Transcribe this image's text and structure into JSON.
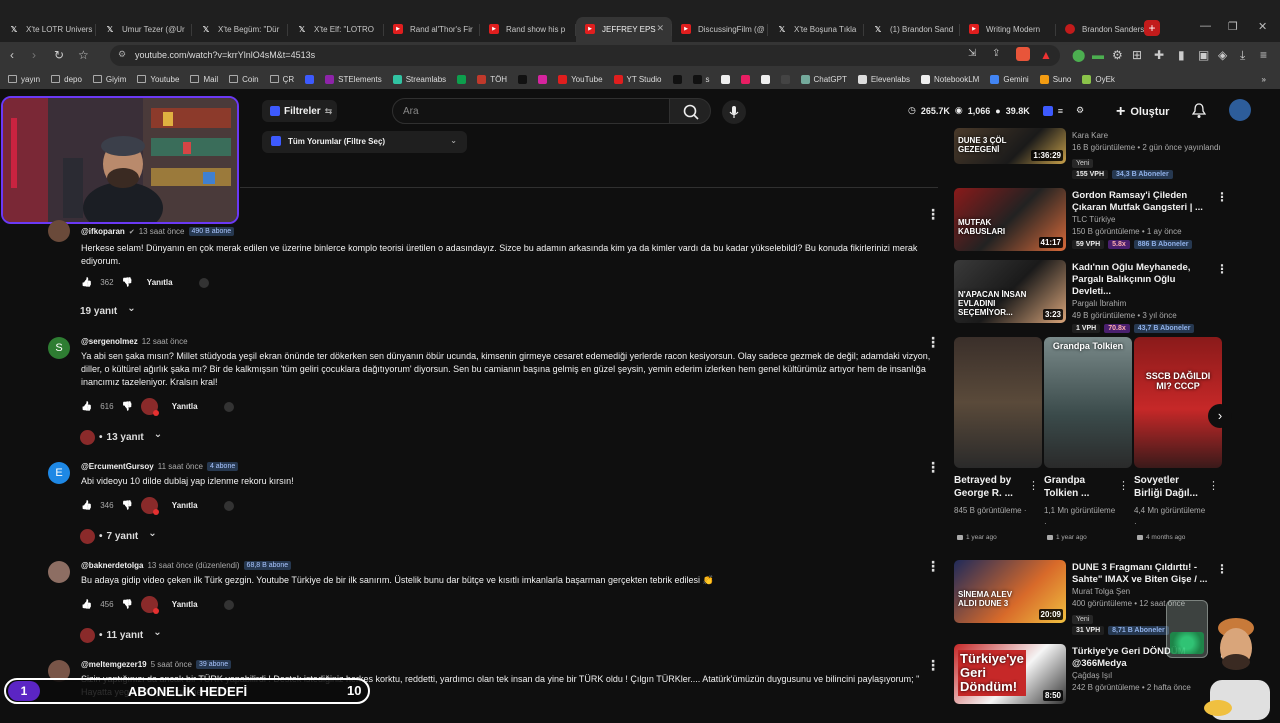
{
  "browser": {
    "tabs": [
      {
        "icon": "x",
        "label": "X'te LOTR Univers",
        "active": false
      },
      {
        "icon": "x",
        "label": "Umur Tezer (@Ur",
        "active": false
      },
      {
        "icon": "x",
        "label": "X'te Begüm: \"Dür",
        "active": false
      },
      {
        "icon": "x",
        "label": "X'te Elf: \"LOTRO",
        "active": false
      },
      {
        "icon": "yt",
        "label": "Rand al'Thor's Fir",
        "active": false
      },
      {
        "icon": "yt",
        "label": "Rand show his p",
        "active": false
      },
      {
        "icon": "yt",
        "label": "JEFFREY EPS",
        "active": true
      },
      {
        "icon": "yt",
        "label": "DiscussingFilm (@",
        "active": false
      },
      {
        "icon": "x",
        "label": "X'te Boşuna Tıkla",
        "active": false
      },
      {
        "icon": "x",
        "label": "(1) Brandon Sand",
        "active": false
      },
      {
        "icon": "yt",
        "label": "Writing Modern",
        "active": false
      },
      {
        "icon": "dr",
        "label": "Brandon Sanders",
        "active": false
      }
    ],
    "url": "youtube.com/watch?v=krrYlnlO4sM&t=4513s",
    "bookmarks": [
      {
        "label": "yayın",
        "icon": "folder"
      },
      {
        "label": "depo",
        "icon": "folder"
      },
      {
        "label": "Giyim",
        "icon": "folder"
      },
      {
        "label": "Youtube",
        "icon": "folder"
      },
      {
        "label": "Mail",
        "icon": "folder"
      },
      {
        "label": "Coin",
        "icon": "folder"
      },
      {
        "label": "ÇR",
        "icon": "folder"
      },
      {
        "label": "",
        "icon": "r"
      },
      {
        "label": "STElements",
        "icon": "st"
      },
      {
        "label": "Streamlabs",
        "icon": "sl"
      },
      {
        "label": "",
        "icon": "k"
      },
      {
        "label": "TÖH",
        "icon": "toh"
      },
      {
        "label": "",
        "icon": "x"
      },
      {
        "label": "",
        "icon": "ig"
      },
      {
        "label": "YouTube",
        "icon": "yt"
      },
      {
        "label": "YT Studio",
        "icon": "yt"
      },
      {
        "label": "",
        "icon": "tt"
      },
      {
        "label": "s",
        "icon": "tt"
      },
      {
        "label": "",
        "icon": "gh"
      },
      {
        "label": "",
        "icon": "pk"
      },
      {
        "label": "",
        "icon": "az"
      },
      {
        "label": "",
        "icon": "z"
      },
      {
        "label": "ChatGPT",
        "icon": "gpt"
      },
      {
        "label": "Elevenlabs",
        "icon": "el"
      },
      {
        "label": "NotebookLM",
        "icon": "nb"
      },
      {
        "label": "Gemini",
        "icon": "gem"
      },
      {
        "label": "Suno",
        "icon": "suno"
      },
      {
        "label": "OyEk",
        "icon": "oy"
      }
    ]
  },
  "header": {
    "filter_label": "Filtreler",
    "search_placeholder": "Ara",
    "stats": [
      "265.7K",
      "1,066",
      "39.8K"
    ],
    "create_label": "Oluştur"
  },
  "comments": {
    "sort_label": "Tüm Yorumlar (Filtre Seç)",
    "items": [
      {
        "avatar_letter": "",
        "user": "@ifkoparan",
        "verified": true,
        "time": "13 saat önce",
        "subs": "490 B abone",
        "text": "Herkese selam! Dünyanın en çok merak edilen ve üzerine binlerce komplo teorisi üretilen o adasındayız. Sizce bu adamın arkasında kim ya da kimler vardı da bu kadar yükselebildi? Bu konuda fikirlerinizi merak ediyorum.",
        "likes": "362",
        "reply_label": "Yanıtla",
        "replies": "19 yanıt"
      },
      {
        "avatar_letter": "S",
        "user": "@sergenolmez",
        "verified": false,
        "time": "12 saat önce",
        "subs": "",
        "text": "Ya abi sen şaka mısın? Millet stüdyoda yeşil ekran önünde ter dökerken sen dünyanın öbür ucunda, kimsenin girmeye cesaret edemediği yerlerde racon kesiyorsun. Olay sadece gezmek de değil; adamdaki vizyon, diller, o kültürel ağırlık şaka mı? Bir de kalkmışsın 'tüm geliri çocuklara dağıtıyorum' diyorsun. Sen bu camianın başına gelmiş en güzel şeysin, yemin ederim izlerken hem genel kültürümüz artıyor hem de insanlığa inancımız tazeleniyor. Kralsın kral!",
        "likes": "616",
        "reply_label": "Yanıtla",
        "replies": "13 yanıt"
      },
      {
        "avatar_letter": "E",
        "user": "@ErcumentGursoy",
        "verified": false,
        "time": "11 saat önce",
        "subs": "4 abone",
        "text": "Abi videoyu 10 dilde dublaj yap izlenme rekoru kırsın!",
        "likes": "346",
        "reply_label": "Yanıtla",
        "replies": "7 yanıt"
      },
      {
        "avatar_letter": "",
        "user": "@baknerdetolga",
        "verified": false,
        "time": "13 saat önce (düzenlendi)",
        "subs": "68,8 B abone",
        "text": "Bu adaya gidip video çeken ilk Türk gezgin. Youtube Türkiye de bir ilk sanırım. Üstelik bunu dar bütçe ve kısıtlı imkanlarla başarman gerçekten tebrik edilesi 👏",
        "likes": "456",
        "reply_label": "Yanıtla",
        "replies": "11 yanıt"
      },
      {
        "avatar_letter": "",
        "user": "@meltemgezer19",
        "verified": false,
        "time": "5 saat önce",
        "subs": "39 abone",
        "text": "Sizin yaptığınızı da ancak bir TÜRK yapabilirdi ! Destek istediğiniz herkes korktu, reddetti, yardımcı olan tek insan da yine bir TÜRK oldu ! Çılgın TÜRKler.... Atatürk'ümüzün duygusunu ve bilincini paylaşıyorum; \" Hayatta yeg... Dünyaya gelmemdir.\"",
        "likes": "",
        "reply_label": "",
        "replies": ""
      }
    ]
  },
  "sidebar": {
    "videos": [
      {
        "title": "",
        "channel": "Kara Kare",
        "meta": "16 B görüntüleme • 2 gün önce yayınlandı",
        "new_label": "Yeni",
        "duration": "1:36:29",
        "thumb_text": "DUNE 3 ÇÖL GEZEGENİ",
        "vph": "155 VPH",
        "multiplier": "",
        "subs": "34,3 B Aboneler"
      },
      {
        "title": "Gordon Ramsay'i Çileden Çıkaran Mutfak Gangsteri | ...",
        "channel": "TLC Türkiye",
        "meta": "150 B görüntüleme • 1 ay önce",
        "new_label": "",
        "duration": "41:17",
        "thumb_text": "MUTFAK KABUSLARI",
        "vph": "59 VPH",
        "multiplier": "5.8x",
        "subs": "886 B Aboneler"
      },
      {
        "title": "Kadı'nın Oğlu Meyhanede, Pargalı Balıkçının Oğlu Devleti...",
        "channel": "Pargalı İbrahim",
        "meta": "49 B görüntüleme • 3 yıl önce",
        "new_label": "",
        "duration": "3:23",
        "thumb_text": "N'APACAN İNSAN EVLADINI SEÇEMİYOR...",
        "vph": "1 VPH",
        "multiplier": "70.8x",
        "subs": "43,7 B Aboneler"
      },
      {
        "title": "DUNE 3 Fragmanı Çıldırttı! - Sahte\" IMAX ve Biten Gişe / ...",
        "channel": "Murat Tolga Şen",
        "meta": "400 görüntüleme • 12 saat önce",
        "new_label": "Yeni",
        "duration": "20:09",
        "thumb_text": "SİNEMA ALEV ALDI DUNE 3",
        "vph": "31 VPH",
        "multiplier": "",
        "subs": "8,71 B Aboneler"
      },
      {
        "title": "Türkiye'ye Geri DÖNDÜM @366Medya",
        "channel": "Çağdaş Işıl",
        "meta": "242 B görüntüleme • 2 hafta önce",
        "new_label": "",
        "duration": "8:50",
        "thumb_text": "Türkiye'ye Geri Döndüm!",
        "vph": "",
        "multiplier": "",
        "subs": ""
      }
    ],
    "shorts": [
      {
        "title": "Betrayed by George R. ...",
        "meta": "845 B görüntüleme ·",
        "date": "1 year ago",
        "label": ""
      },
      {
        "title": "Grandpa Tolkien ...",
        "meta": "1,1 Mn görüntüleme ·",
        "date": "1 year ago",
        "label": "Grandpa Tolkien"
      },
      {
        "title": "Sovyetler Birliği Dağıl...",
        "meta": "4,4 Mn görüntüleme ·",
        "date": "4 months ago",
        "label": "SSCB DAĞILDI MI? CCCP"
      }
    ]
  },
  "overlay": {
    "goal_start": "1",
    "goal_label": "ABONELİK HEDEFİ",
    "goal_end": "10"
  }
}
